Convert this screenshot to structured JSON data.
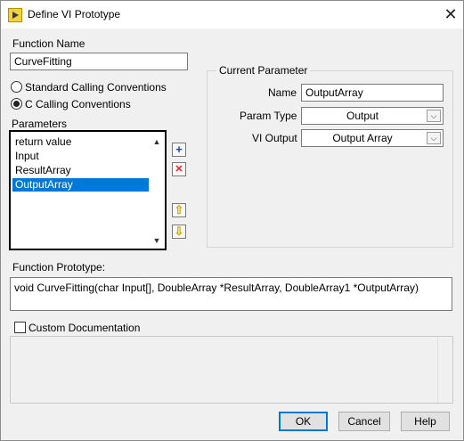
{
  "window": {
    "title": "Define VI Prototype",
    "close": "✕"
  },
  "function_name": {
    "label": "Function Name",
    "value": "CurveFitting"
  },
  "calling_conventions": {
    "standard": "Standard Calling Conventions",
    "c": "C Calling Conventions",
    "selected": "c"
  },
  "parameters": {
    "label": "Parameters",
    "items": [
      "return value",
      "Input",
      "ResultArray",
      "OutputArray"
    ],
    "selected_index": 3,
    "add_icon": "+",
    "remove_icon": "✕",
    "move_up_icon": "⇧",
    "move_down_icon": "⇩",
    "scroll_up": "▲",
    "scroll_down": "▼"
  },
  "current_parameter": {
    "title": "Current Parameter",
    "name_label": "Name",
    "name_value": "OutputArray",
    "param_type_label": "Param Type",
    "param_type_value": "Output",
    "vi_output_label": "VI Output",
    "vi_output_value": "Output Array",
    "dropdown_arrow": "⌵"
  },
  "prototype": {
    "label": "Function Prototype:",
    "value": "void CurveFitting(char Input[], DoubleArray *ResultArray, DoubleArray1 *OutputArray)"
  },
  "custom_doc": {
    "label": "Custom Documentation",
    "checked": false
  },
  "buttons": {
    "ok": "OK",
    "cancel": "Cancel",
    "help": "Help"
  },
  "colors": {
    "selection": "#0078d7",
    "add_icon": "#1a3fb5",
    "remove_icon": "#e02020",
    "arrow_icon": "#e8c200"
  }
}
